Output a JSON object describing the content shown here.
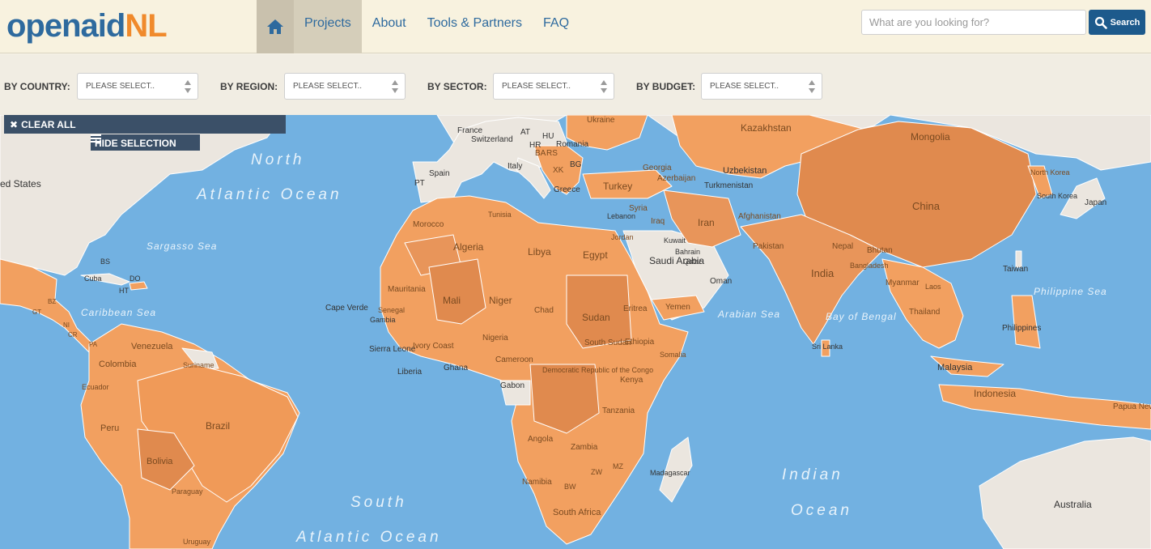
{
  "header": {
    "logo_part1": "openaid",
    "logo_part2": "NL",
    "nav": [
      "Projects",
      "About",
      "Tools & Partners",
      "FAQ"
    ],
    "search_placeholder": "What are you looking for?",
    "search_button": "Search"
  },
  "filters": [
    {
      "label": "BY COUNTRY:",
      "value": "PLEASE SELECT.."
    },
    {
      "label": "BY REGION:",
      "value": "PLEASE SELECT.."
    },
    {
      "label": "BY SECTOR:",
      "value": "PLEASE SELECT.."
    },
    {
      "label": "BY BUDGET:",
      "value": "PLEASE SELECT.."
    }
  ],
  "map": {
    "clear_all": "CLEAR ALL",
    "hide_selection": "HIDE SELECTION",
    "colors": {
      "ocean": "#72b1e1",
      "highlight": "#f2a060",
      "highlight_dark": "#e09054",
      "land": "#ebe6df",
      "border": "#ffffff"
    },
    "ocean_labels": [
      "North",
      "Atlantic Ocean",
      "Sargasso Sea",
      "Caribbean Sea",
      "South",
      "Atlantic Ocean",
      "Indian",
      "Ocean",
      "Arabian Sea",
      "Bay of Bengal",
      "Philippine Sea"
    ],
    "countries": [
      "France",
      "Switzerland",
      "AT",
      "HU",
      "Romania",
      "Ukraine",
      "Kazakhstan",
      "Mongolia",
      "Spain",
      "PT",
      "Italy",
      "HR",
      "BA",
      "RS",
      "XK",
      "BG",
      "Greece",
      "Georgia",
      "Azerbaijan",
      "Uzbekistan",
      "Turkmenistan",
      "North Korea",
      "South Korea",
      "Japan",
      "Turkey",
      "Tunisia",
      "Syria",
      "Lebanon",
      "Iraq",
      "Iran",
      "Afghanistan",
      "China",
      "Morocco",
      "Algeria",
      "Libya",
      "Egypt",
      "Jordan",
      "Kuwait",
      "Bahrain",
      "Qatar",
      "Saudi Arabia",
      "Pakistan",
      "Nepal",
      "Bhutan",
      "Bangladesh",
      "India",
      "Myanmar",
      "Laos",
      "Taiwan",
      "Mauritania",
      "Mali",
      "Niger",
      "Chad",
      "Sudan",
      "Eritrea",
      "Yemen",
      "Oman",
      "Thailand",
      "Cape Verde",
      "Senegal",
      "Gambia",
      "Sierra Leone",
      "Liberia",
      "Ivory Coast",
      "Ghana",
      "Nigeria",
      "Cameroon",
      "South Sudan",
      "Ethiopia",
      "Somalia",
      "Sri Lanka",
      "Philippines",
      "Malaysia",
      "Gabon",
      "Democratic Republic of the Congo",
      "Kenya",
      "Tanzania",
      "Indonesia",
      "Papua New Guinea",
      "Angola",
      "Zambia",
      "ZW",
      "MZ",
      "Madagascar",
      "Namibia",
      "BW",
      "South Africa",
      "Australia",
      "ed States",
      "BS",
      "Cuba",
      "DO",
      "HT",
      "BZ",
      "GT",
      "NI",
      "CR",
      "PA",
      "Venezuela",
      "Colombia",
      "Suriname",
      "Ecuador",
      "Peru",
      "Brazil",
      "Bolivia",
      "Paraguay",
      "Uruguay"
    ]
  }
}
